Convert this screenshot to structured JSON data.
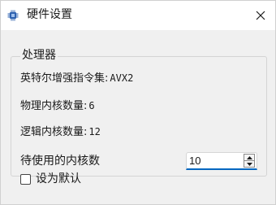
{
  "window": {
    "title": "硬件设置",
    "icon": "cpu-chip-icon",
    "close_icon": "close-icon"
  },
  "processor_group": {
    "title": "处理器",
    "rows": [
      {
        "label": "英特尔增强指令集:",
        "value": "AVX2"
      },
      {
        "label": "物理内核数量:",
        "value": "6"
      },
      {
        "label": "逻辑内核数量:",
        "value": "12"
      }
    ]
  },
  "cores_setting": {
    "label": "待使用的内核数",
    "value": "10"
  },
  "default_checkbox": {
    "label": "设为默认",
    "checked": false
  },
  "colors": {
    "accent": "#0067c0",
    "chip": "#2e62b0"
  }
}
